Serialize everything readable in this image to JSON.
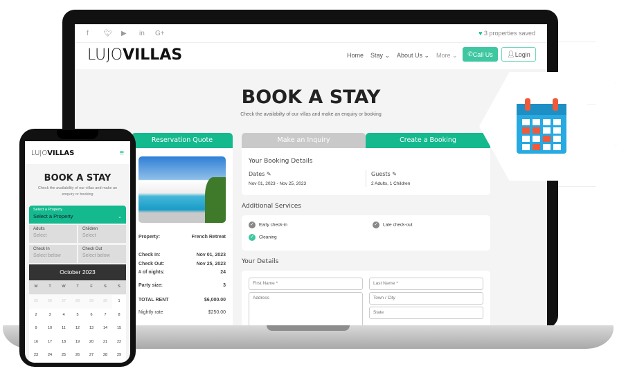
{
  "topbar": {
    "social": [
      "f",
      "t",
      "yt",
      "in",
      "G+"
    ],
    "saved": "3 properties saved"
  },
  "nav": {
    "logo_light": "LUJO",
    "logo_bold": "VILLAS",
    "items": [
      "Home",
      "Stay ⌄",
      "About Us ⌄",
      "More ⌄"
    ],
    "call": "Call Us",
    "login": "Login"
  },
  "hero": {
    "title": "BOOK A STAY",
    "subtitle": "Check the availabilty of our villas and make an enquiry or booking"
  },
  "quote": {
    "header": "Reservation Quote",
    "rows": [
      {
        "label": "Property:",
        "value": "French Retreat"
      },
      {
        "label": "Check In:",
        "value": "Nov 01, 2023"
      },
      {
        "label": "Check Out:",
        "value": "Nov 25, 2023"
      },
      {
        "label": "# of nights:",
        "value": "24"
      },
      {
        "label": "Party size:",
        "value": "3"
      },
      {
        "label": "TOTAL RENT",
        "value": "$6,000.00"
      },
      {
        "label": "Nightly rate",
        "value": "$250.00"
      }
    ]
  },
  "tabs": {
    "inquiry": "Make an Inquiry",
    "booking": "Create a Booking"
  },
  "booking": {
    "title": "Your Booking Details",
    "dates_label": "Dates",
    "dates": "Nov 01, 2023 - Nov 25, 2023",
    "guests_label": "Guests",
    "guests": "2 Adults, 1 Children"
  },
  "services": {
    "title": "Additional Services",
    "items": [
      {
        "label": "Early check-in",
        "checked": false
      },
      {
        "label": "Late check-out",
        "checked": false
      },
      {
        "label": "Cleaning",
        "checked": true
      }
    ]
  },
  "details": {
    "title": "Your Details",
    "first": "First Name *",
    "last": "Last Name *",
    "address": "Address",
    "town": "Town / City",
    "state": "State"
  },
  "phone": {
    "logo_light": "LUJO",
    "logo_bold": "VILLAS",
    "title": "BOOK A STAY",
    "subtitle": "Check the availability of our villas and make an enquiry or booking",
    "select_label": "Select a Property",
    "select_value": "Select a Property",
    "adults": "Adults",
    "children": "Children",
    "select": "Select",
    "checkin": "Check In",
    "checkout": "Check Out",
    "below": "Select below",
    "month": "October 2023",
    "days": [
      "M",
      "T",
      "W",
      "T",
      "F",
      "S",
      "S"
    ],
    "weeks": [
      [
        "25",
        "26",
        "27",
        "28",
        "29",
        "30",
        "1"
      ],
      [
        "2",
        "3",
        "4",
        "5",
        "6",
        "7",
        "8"
      ],
      [
        "9",
        "10",
        "11",
        "12",
        "13",
        "14",
        "15"
      ],
      [
        "16",
        "17",
        "18",
        "19",
        "20",
        "21",
        "22"
      ],
      [
        "23",
        "24",
        "25",
        "26",
        "27",
        "28",
        "29"
      ]
    ]
  },
  "colors": {
    "accent": "#14b98e",
    "dark": "#333333"
  },
  "icons": {
    "badge": "calendar-icon"
  }
}
